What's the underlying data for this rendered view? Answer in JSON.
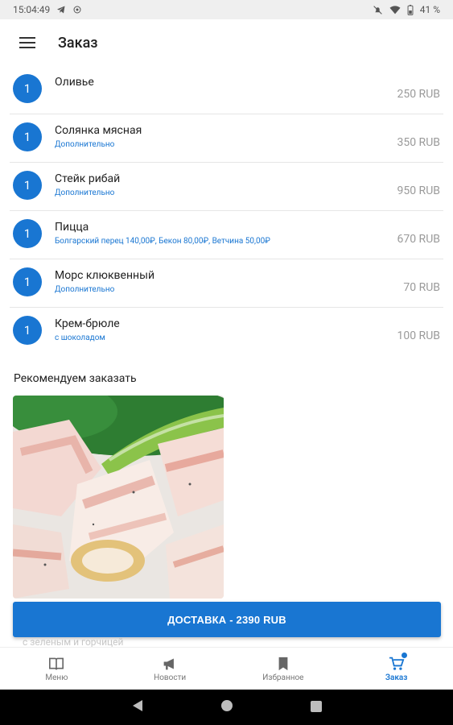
{
  "status": {
    "time": "15:04:49",
    "battery": "41 %"
  },
  "appbar": {
    "title": "Заказ"
  },
  "orders": [
    {
      "qty": "1",
      "name": "Оливье",
      "sub": "",
      "price": "250 RUB"
    },
    {
      "qty": "1",
      "name": "Солянка мясная",
      "sub": "Дополнительно",
      "price": "350 RUB"
    },
    {
      "qty": "1",
      "name": "Стейк рибай",
      "sub": "Дополнительно",
      "price": "950 RUB"
    },
    {
      "qty": "1",
      "name": "Пицца",
      "sub": "Болгарский перец 140,00₽, Бекон 80,00₽, Ветчина 50,00₽",
      "price": "670 RUB"
    },
    {
      "qty": "1",
      "name": "Морс клюквенный",
      "sub": "Дополнительно",
      "price": "70 RUB"
    },
    {
      "qty": "1",
      "name": "Крем-брюле",
      "sub": "с шоколадом",
      "price": "100 RUB"
    }
  ],
  "recommend": {
    "title": "Рекомендуем заказать",
    "peek_text": "с зеленым и горчицей"
  },
  "cta": {
    "label": "ДОСТАВКА - 2390 RUB"
  },
  "nav": [
    {
      "label": "Меню",
      "icon": "book-icon"
    },
    {
      "label": "Новости",
      "icon": "megaphone-icon"
    },
    {
      "label": "Избранное",
      "icon": "bookmark-icon"
    },
    {
      "label": "Заказ",
      "icon": "cart-icon"
    }
  ],
  "colors": {
    "accent": "#1976d2"
  }
}
